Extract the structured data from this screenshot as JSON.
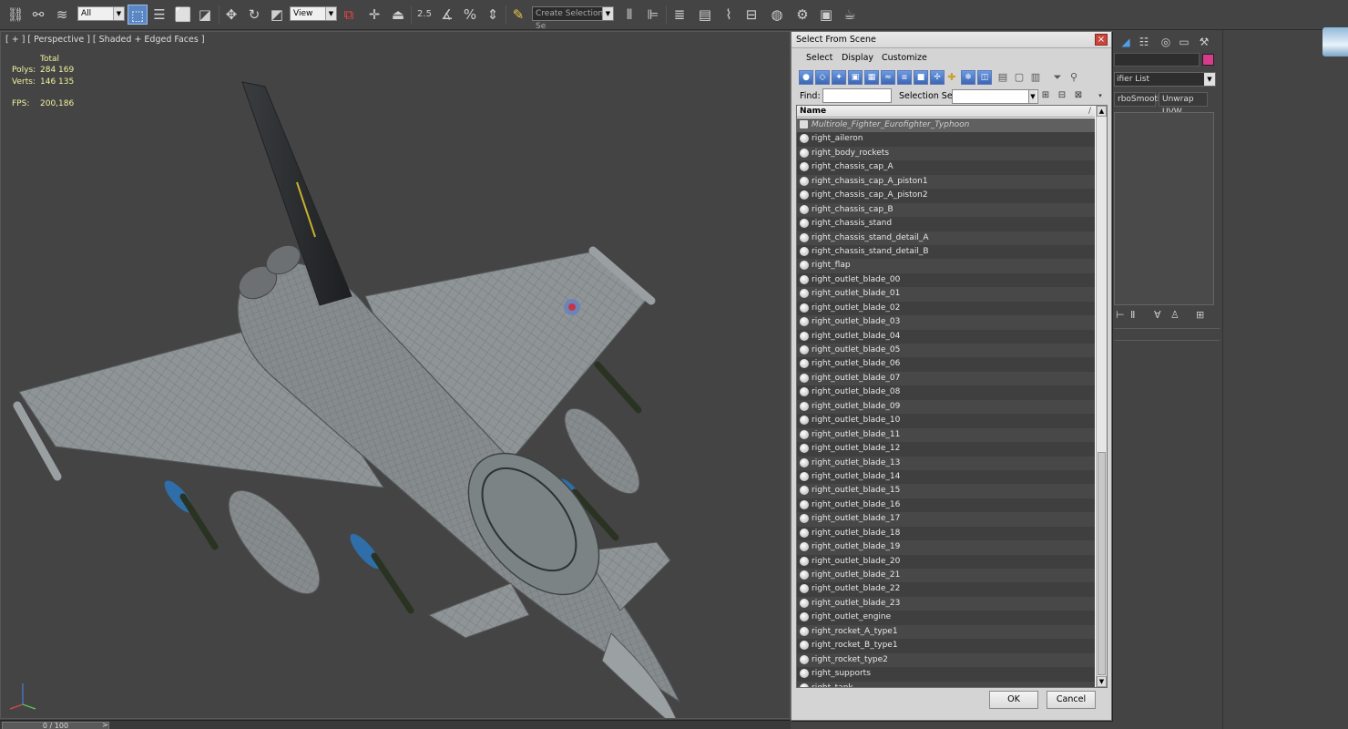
{
  "toolbar": {
    "filter_value": "All",
    "view_value": "View",
    "snap_value": "2.5",
    "selection_set_placeholder": "Create Selection Se",
    "icons": [
      "link-icon",
      "unlink-icon",
      "bind-space-warp-icon",
      "select-object-icon",
      "select-by-name-icon",
      "rect-region-icon",
      "window-crossing-icon",
      "move-icon",
      "rotate-icon",
      "scale-icon",
      "use-pivot-icon",
      "select-manipulate-icon",
      "keyboard-shortcut-icon",
      "snaps-toggle-icon",
      "angle-snap-icon",
      "percent-snap-icon",
      "spinner-snap-icon",
      "edit-named-sets-icon",
      "mirror-icon",
      "align-icon",
      "layer-manager-icon",
      "ribbon-icon",
      "curve-editor-icon",
      "schematic-view-icon",
      "material-editor-icon",
      "render-setup-icon",
      "rendered-frame-icon",
      "render-icon"
    ]
  },
  "viewport": {
    "label": "[ + ] [ Perspective ] [ Shaded + Edged Faces ]",
    "stats": {
      "total_label": "Total",
      "polys_label": "Polys:",
      "polys_value": "284 169",
      "verts_label": "Verts:",
      "verts_value": "146 135",
      "fps_label": "FPS:",
      "fps_value": "200,186"
    }
  },
  "timeline": {
    "frame": "0 / 100",
    "next": ">"
  },
  "command_panel": {
    "modifier_list": "ifier List",
    "btn_turbosmooth": "rboSmooth",
    "btn_unwrap": "Unwrap UVW",
    "object_color": "#d83b8d"
  },
  "dialog": {
    "title": "Select From Scene",
    "menu": {
      "select": "Select",
      "display": "Display",
      "customize": "Customize"
    },
    "find_label": "Find:",
    "find_value": "",
    "selection_set_label": "Selection Set:",
    "selection_set_value": "",
    "column_name": "Name",
    "sort_indicator": "/",
    "rows": [
      {
        "name": "Multirole_Fighter_Eurofighter_Typhoon",
        "root": true
      },
      {
        "name": "right_aileron"
      },
      {
        "name": "right_body_rockets"
      },
      {
        "name": "right_chassis_cap_A"
      },
      {
        "name": "right_chassis_cap_A_piston1"
      },
      {
        "name": "right_chassis_cap_A_piston2"
      },
      {
        "name": "right_chassis_cap_B"
      },
      {
        "name": "right_chassis_stand"
      },
      {
        "name": "right_chassis_stand_detail_A"
      },
      {
        "name": "right_chassis_stand_detail_B"
      },
      {
        "name": "right_flap"
      },
      {
        "name": "right_outlet_blade_00"
      },
      {
        "name": "right_outlet_blade_01"
      },
      {
        "name": "right_outlet_blade_02"
      },
      {
        "name": "right_outlet_blade_03"
      },
      {
        "name": "right_outlet_blade_04"
      },
      {
        "name": "right_outlet_blade_05"
      },
      {
        "name": "right_outlet_blade_06"
      },
      {
        "name": "right_outlet_blade_07"
      },
      {
        "name": "right_outlet_blade_08"
      },
      {
        "name": "right_outlet_blade_09"
      },
      {
        "name": "right_outlet_blade_10"
      },
      {
        "name": "right_outlet_blade_11"
      },
      {
        "name": "right_outlet_blade_12"
      },
      {
        "name": "right_outlet_blade_13"
      },
      {
        "name": "right_outlet_blade_14"
      },
      {
        "name": "right_outlet_blade_15"
      },
      {
        "name": "right_outlet_blade_16"
      },
      {
        "name": "right_outlet_blade_17"
      },
      {
        "name": "right_outlet_blade_18"
      },
      {
        "name": "right_outlet_blade_19"
      },
      {
        "name": "right_outlet_blade_20"
      },
      {
        "name": "right_outlet_blade_21"
      },
      {
        "name": "right_outlet_blade_22"
      },
      {
        "name": "right_outlet_blade_23"
      },
      {
        "name": "right_outlet_engine"
      },
      {
        "name": "right_rocket_A_type1"
      },
      {
        "name": "right_rocket_B_type1"
      },
      {
        "name": "right_rocket_type2"
      },
      {
        "name": "right_supports"
      },
      {
        "name": "right_tank"
      }
    ],
    "ok_label": "OK",
    "cancel_label": "Cancel"
  }
}
